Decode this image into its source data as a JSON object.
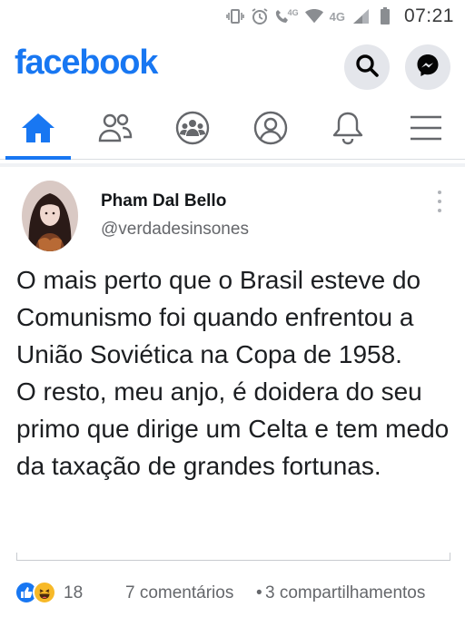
{
  "status_bar": {
    "network_label": "4G",
    "network_label_2": "4G",
    "time": "07:21"
  },
  "header": {
    "logo": "facebook",
    "brand_color": "#1877f2",
    "icons": [
      "search-icon",
      "messenger-icon"
    ]
  },
  "nav": {
    "tabs": [
      {
        "icon": "home-icon",
        "active": true
      },
      {
        "icon": "friends-icon",
        "active": false
      },
      {
        "icon": "groups-icon",
        "active": false
      },
      {
        "icon": "profile-icon",
        "active": false
      },
      {
        "icon": "notifications-icon",
        "active": false
      },
      {
        "icon": "menu-icon",
        "active": false
      }
    ]
  },
  "tweet": {
    "author_name": "Pham Dal Bello",
    "author_handle": "@verdadesinsones",
    "paragraph_1": "O mais perto que o Brasil esteve do Comunismo foi quando enfrentou a União Soviética na Copa de 1958.",
    "paragraph_2": "O resto, meu anjo, é doidera do seu primo que dirige um Celta e tem medo da taxação de grandes fortunas."
  },
  "footer": {
    "reactions": [
      "like-icon",
      "haha-icon"
    ],
    "reaction_count": "18",
    "comments": "7 comentários",
    "separator": "•",
    "shares": "3 compartilhamentos"
  }
}
